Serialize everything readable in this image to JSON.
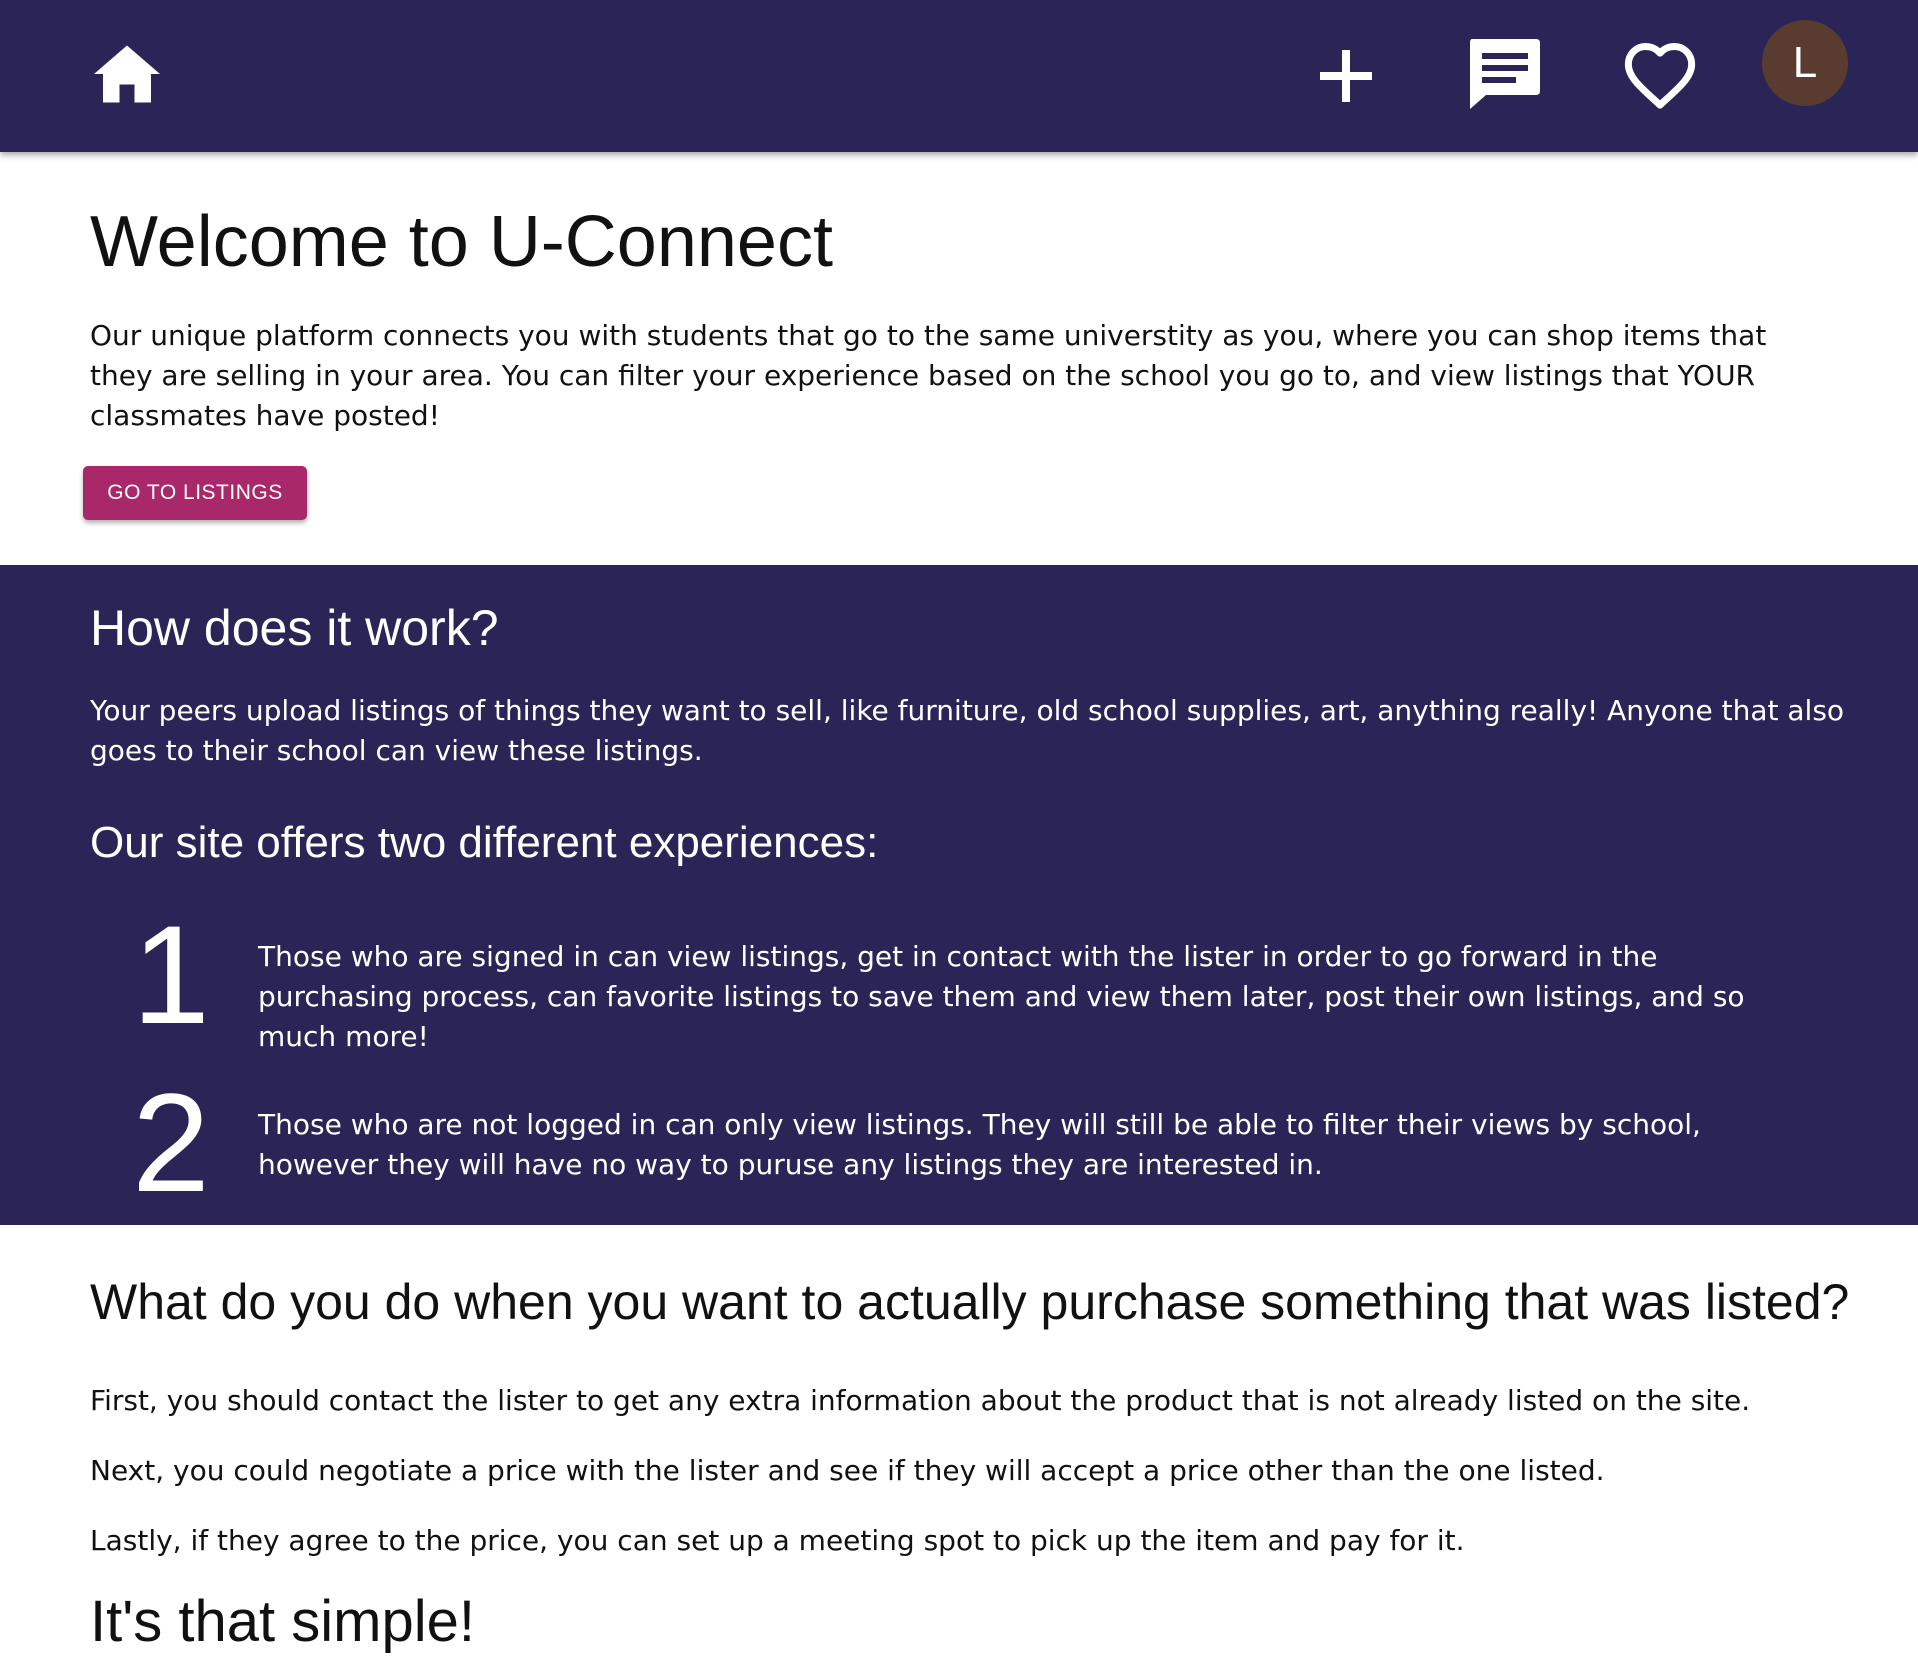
{
  "nav": {
    "home_icon": "home-icon",
    "add_icon": "plus-icon",
    "messages_icon": "chat-message-icon",
    "favorites_icon": "heart-outline-icon",
    "avatar_initial": "L",
    "bar_color": "#2b2557",
    "avatar_color": "#5a3b30"
  },
  "intro": {
    "title": "Welcome to U-Connect",
    "body": "Our unique platform connects you with students that go to the same universtity as you, where you can shop items that they are selling in your area. You can filter your experience based on the school you go to, and view listings that YOUR classmates have posted!",
    "cta_label": "GO TO LISTINGS",
    "cta_color": "#a8286a"
  },
  "how": {
    "title": "How does it work?",
    "body": "Your peers upload listings of things they want to sell, like furniture, old school supplies, art, anything really! Anyone that also goes to their school can view these listings.",
    "subtitle": "Our site offers two different experiences:",
    "steps": [
      {
        "number": "1",
        "text": "Those who are signed in can view listings, get in contact with the lister in order to go forward in the purchasing process, can favorite listings to save them and view them later, post their own listings, and so much more!"
      },
      {
        "number": "2",
        "text": "Those who are not logged in can only view listings. They will still be able to filter their views by school, however they will have no way to puruse any listings they are interested in."
      }
    ]
  },
  "purchase": {
    "title": "What do you do when you want to actually purchase something that was listed?",
    "steps": [
      "First, you should contact the lister to get any extra information about the product that is not already listed on the site.",
      "Next, you could negotiate a price with the lister and see if they will accept a price other than the one listed.",
      "Lastly, if they agree to the price, you can set up a meeting spot to pick up the item and pay for it."
    ],
    "closing": "It's that simple!"
  }
}
